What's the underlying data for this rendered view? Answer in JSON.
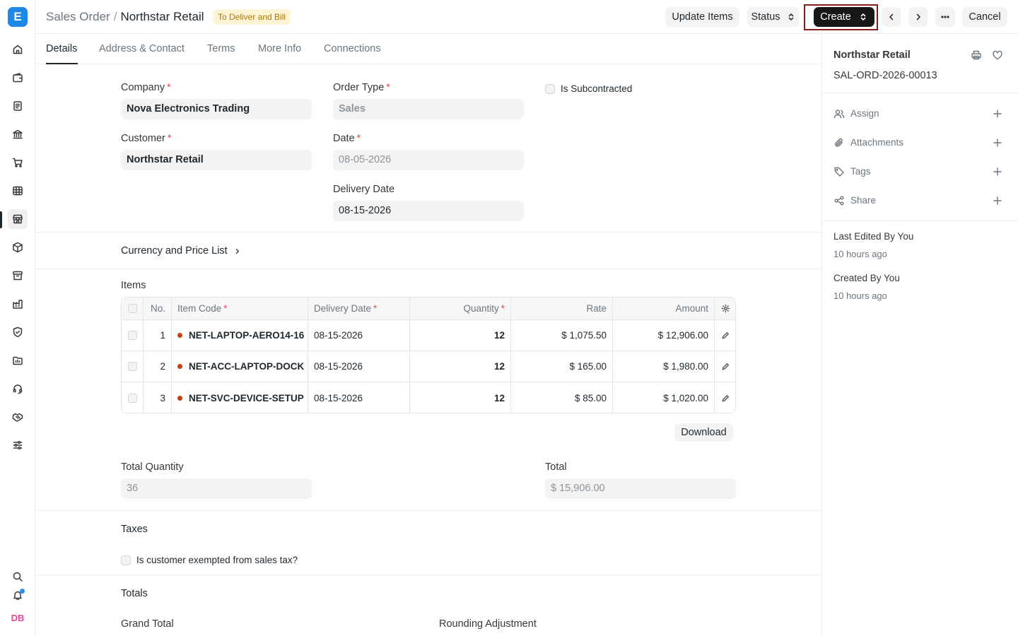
{
  "app": {
    "logo_letter": "E"
  },
  "user": {
    "initials": "DB"
  },
  "breadcrumb": {
    "parent": "Sales Order",
    "separator": "/",
    "current": "Northstar Retail"
  },
  "status_badge": "To Deliver and Bill",
  "toolbar": {
    "update_items": "Update Items",
    "status": "Status",
    "create": "Create",
    "cancel": "Cancel"
  },
  "tabs": [
    "Details",
    "Address & Contact",
    "Terms",
    "More Info",
    "Connections"
  ],
  "form": {
    "company": {
      "label": "Company",
      "value": "Nova Electronics Trading"
    },
    "order_type": {
      "label": "Order Type",
      "value": "Sales"
    },
    "is_subcontracted": {
      "label": "Is Subcontracted"
    },
    "customer": {
      "label": "Customer",
      "value": "Northstar Retail"
    },
    "date": {
      "label": "Date",
      "value": "08-05-2026"
    },
    "delivery_date": {
      "label": "Delivery Date",
      "value": "08-15-2026"
    },
    "currency_section": "Currency and Price List",
    "items_label": "Items"
  },
  "items_table": {
    "headers": {
      "no": "No.",
      "item_code": "Item Code",
      "delivery_date": "Delivery Date",
      "quantity": "Quantity",
      "rate": "Rate",
      "amount": "Amount"
    },
    "rows": [
      {
        "no": "1",
        "item_code": "NET-LAPTOP-AERO14-16",
        "delivery_date": "08-15-2026",
        "quantity": "12",
        "rate": "$ 1,075.50",
        "amount": "$ 12,906.00"
      },
      {
        "no": "2",
        "item_code": "NET-ACC-LAPTOP-DOCK",
        "delivery_date": "08-15-2026",
        "quantity": "12",
        "rate": "$ 165.00",
        "amount": "$ 1,980.00"
      },
      {
        "no": "3",
        "item_code": "NET-SVC-DEVICE-SETUP",
        "delivery_date": "08-15-2026",
        "quantity": "12",
        "rate": "$ 85.00",
        "amount": "$ 1,020.00"
      }
    ],
    "download": "Download"
  },
  "summary": {
    "total_quantity": {
      "label": "Total Quantity",
      "value": "36"
    },
    "total": {
      "label": "Total",
      "value": "$ 15,906.00"
    }
  },
  "taxes": {
    "title": "Taxes",
    "exempt_label": "Is customer exempted from sales tax?"
  },
  "totals": {
    "title": "Totals",
    "grand_total": "Grand Total",
    "rounding_adjustment": "Rounding Adjustment"
  },
  "sidebar": {
    "title": "Northstar Retail",
    "doc_id": "SAL-ORD-2026-00013",
    "actions": [
      "Assign",
      "Attachments",
      "Tags",
      "Share"
    ],
    "last_edited": "Last Edited By You",
    "last_edited_time": "10 hours ago",
    "created": "Created By You",
    "created_time": "10 hours ago"
  }
}
